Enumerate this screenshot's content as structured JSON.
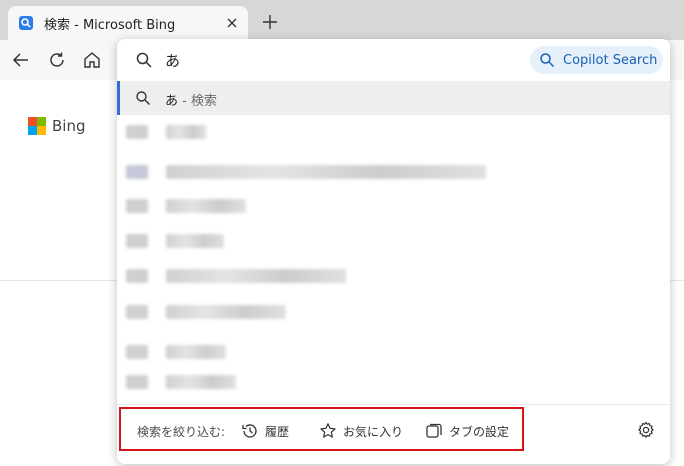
{
  "tab": {
    "title": "検索 - Microsoft Bing",
    "favicon": "bing-search-icon"
  },
  "toolbar": {
    "back": "back-icon",
    "refresh": "refresh-icon",
    "home": "home-icon"
  },
  "page": {
    "logo_text": "Bing"
  },
  "addressbar": {
    "value": "あ",
    "copilot_label": "Copilot Search"
  },
  "suggestions": {
    "selected": {
      "query": "あ",
      "separator": " - ",
      "action": "検索"
    },
    "blurred_count": 8
  },
  "filter_bar": {
    "label": "検索を絞り込む:",
    "items": [
      {
        "label": "履歴",
        "icon": "history-icon"
      },
      {
        "label": "お気に入り",
        "icon": "star-icon"
      },
      {
        "label": "タブの設定",
        "icon": "tabs-icon"
      }
    ],
    "highlight_color": "#d8131a"
  },
  "colors": {
    "accent": "#2f6fd6",
    "copilot_bg": "#e5f0fb",
    "copilot_text": "#1a5fb4"
  }
}
